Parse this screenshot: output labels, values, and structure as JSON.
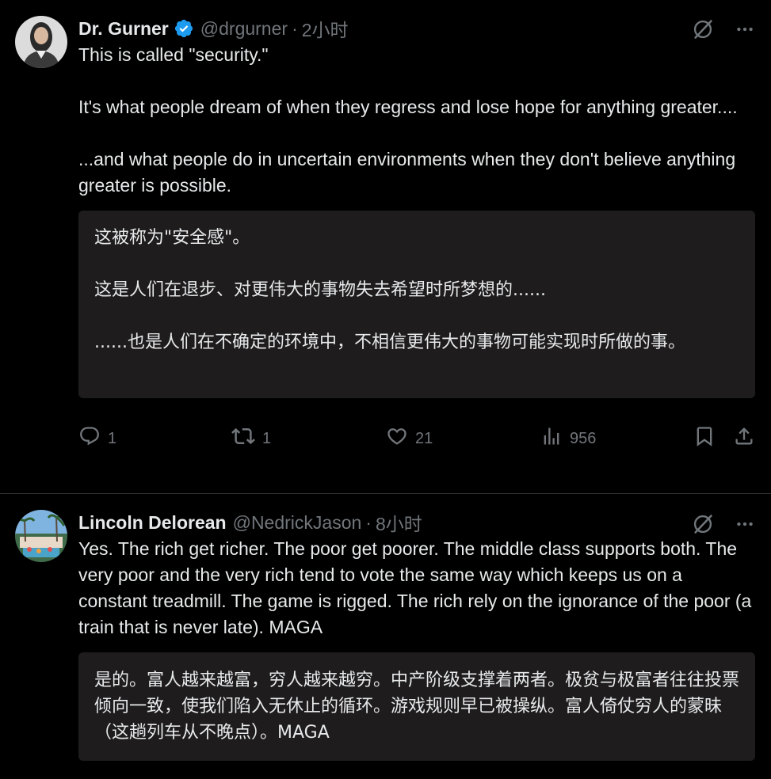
{
  "tweets": [
    {
      "display_name": "Dr.      Gurner",
      "handle": "@drgurner",
      "separator": "·",
      "time": "2小时",
      "verified": true,
      "text": "This is called \"security.\"\n\nIt's what people dream of when they regress and lose hope for anything greater....\n\n...and what people do in uncertain environments when they don't believe anything greater is possible.",
      "translation": "这被称为\"安全感\"。\n\n这是人们在退步、对更伟大的事物失去希望时所梦想的......\n\n......也是人们在不确定的环境中，不相信更伟大的事物可能实现时所做的事。",
      "stats": {
        "replies": "1",
        "retweets": "1",
        "likes": "21",
        "views": "956"
      }
    },
    {
      "display_name": "Lincoln Delorean",
      "handle": "@NedrickJason",
      "separator": "·",
      "time": "8小时",
      "verified": false,
      "text": "Yes. The rich get richer. The poor get poorer. The middle class supports both. The very poor and the very rich tend to vote the same way which keeps us on a constant treadmill. The game is rigged. The rich rely on the ignorance of the poor (a train that is never late). MAGA",
      "translation": "是的。富人越来越富，穷人越来越穷。中产阶级支撑着两者。极贫与极富者往往投票倾向一致，使我们陷入无休止的循环。游戏规则早已被操纵。富人倚仗穷人的蒙昧（这趟列车从不晚点）。MAGA"
    }
  ],
  "icons": {
    "verified": "verified-badge-icon",
    "grok": "grok-icon",
    "more": "more-icon",
    "reply": "reply-icon",
    "retweet": "retweet-icon",
    "like": "like-icon",
    "views": "views-icon",
    "bookmark": "bookmark-icon",
    "share": "share-icon"
  },
  "colors": {
    "background": "#000000",
    "text_primary": "#e7e9ea",
    "text_secondary": "#71767b",
    "verified_blue": "#1d9bf0",
    "translation_bg": "#1e1c1d",
    "divider": "#2f3336"
  }
}
